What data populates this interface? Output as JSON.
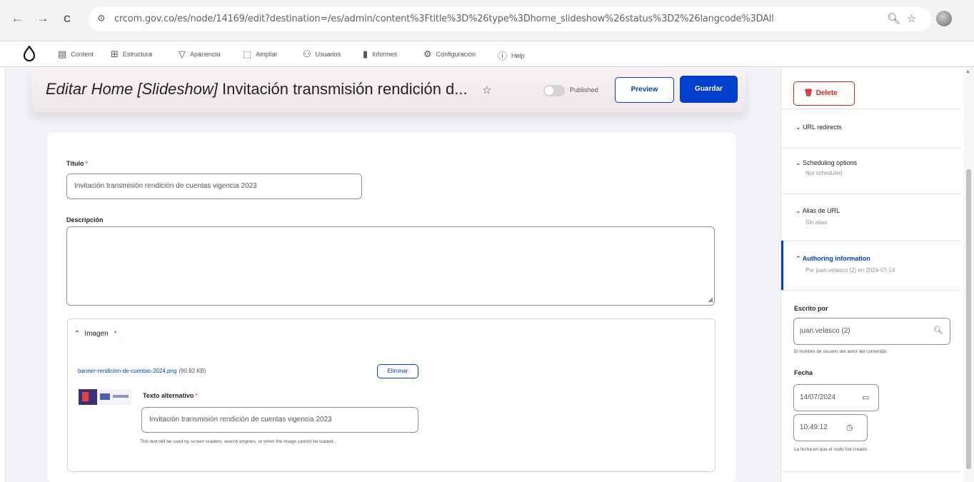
{
  "browser": {
    "back_icon": "←",
    "forward_icon": "→",
    "reload_icon": "C",
    "url": "crcom.gov.co/es/node/14169/edit?destination=/es/admin/content%3Ftitle%3D%26type%3Dhome_slideshow%26status%3D2%26langcode%3DAll"
  },
  "toolbar": {
    "items": [
      {
        "label": "Content",
        "icon": "content-icon"
      },
      {
        "label": "Estructura",
        "icon": "structure-icon"
      },
      {
        "label": "Apariencia",
        "icon": "appearance-icon"
      },
      {
        "label": "Ampliar",
        "icon": "extend-icon"
      },
      {
        "label": "Usuarios",
        "icon": "users-icon"
      },
      {
        "label": "Informes",
        "icon": "reports-icon"
      },
      {
        "label": "Configuración",
        "icon": "config-icon"
      },
      {
        "label": "Help",
        "icon": "help-icon"
      }
    ]
  },
  "header": {
    "title_prefix": "Editar Home [Slideshow]",
    "title_rest": "Invitación transmisión rendición d...",
    "published_label": "Published",
    "published": false,
    "preview_label": "Preview",
    "save_label": "Guardar"
  },
  "form": {
    "title_label": "Título",
    "title_value": "Invitación transmisión rendición de cuentas vigencia 2023",
    "description_label": "Descripción",
    "image": {
      "summary_label": "Imagen",
      "file_name": "banner-rendicion-de-cuentas-2024.png",
      "file_size": "(90.92 KB)",
      "remove_label": "Eliminar",
      "alt_label": "Texto alternativo",
      "alt_value": "Invitación transmisión rendición de cuentas vigencia 2023",
      "alt_help": "This text will be used by screen readers, search engines, or when the image cannot be loaded."
    }
  },
  "sidebar": {
    "delete_label": "Delete",
    "sections": [
      {
        "title": "URL redirects",
        "subtitle": ""
      },
      {
        "title": "Scheduling options",
        "subtitle": "Not scheduled"
      },
      {
        "title": "Alias de URL",
        "subtitle": "Sin alias"
      },
      {
        "title": "Authoring information",
        "subtitle": "Por juan.velasco (2) en 2024-07-14"
      }
    ],
    "author_label": "Escrito por",
    "author_value": "juan.velasco (2)",
    "author_help": "El nombre de usuario del autor del contenido.",
    "date_label": "Fecha",
    "date_value": "14/07/2024",
    "time_value": "10:49:12",
    "date_help": "La fecha en que el nodo fue creado."
  },
  "colors": {
    "accent": "#003ecc",
    "danger": "#d72222",
    "background": "#f3f4f9"
  }
}
